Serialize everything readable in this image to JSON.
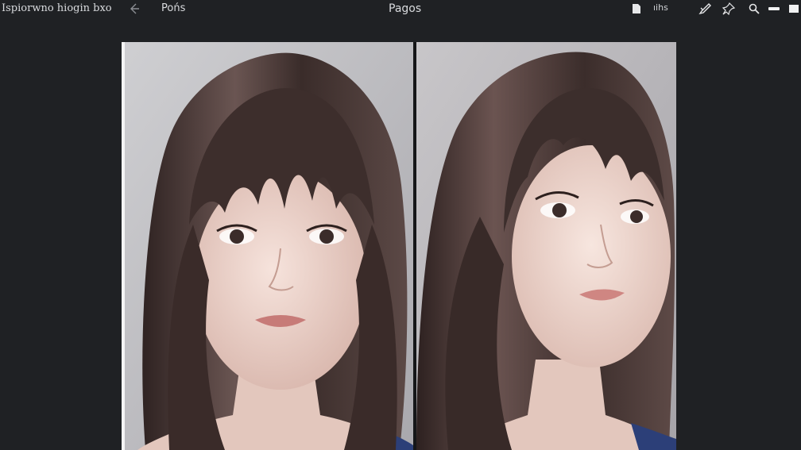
{
  "header": {
    "app_title": "Ispiorwno hiogin bxo",
    "nav_label": "Pońs",
    "page_title": "Pagos",
    "counter_text": "ıihs"
  },
  "icons": {
    "back": "back-arrow-icon",
    "page": "page-icon",
    "pen": "pen-icon",
    "pin": "pin-icon",
    "search": "search-icon",
    "minimize": "minimize-icon",
    "close": "close-icon"
  },
  "colors": {
    "app_background": "#1f2124",
    "text": "#d9dbde",
    "photo_background": "#c9c8cb",
    "hair": "#4a3a37",
    "skin": "#ecd4cc",
    "top": "#2c3f78"
  },
  "photos": [
    {
      "name": "portrait-left"
    },
    {
      "name": "portrait-right"
    }
  ]
}
